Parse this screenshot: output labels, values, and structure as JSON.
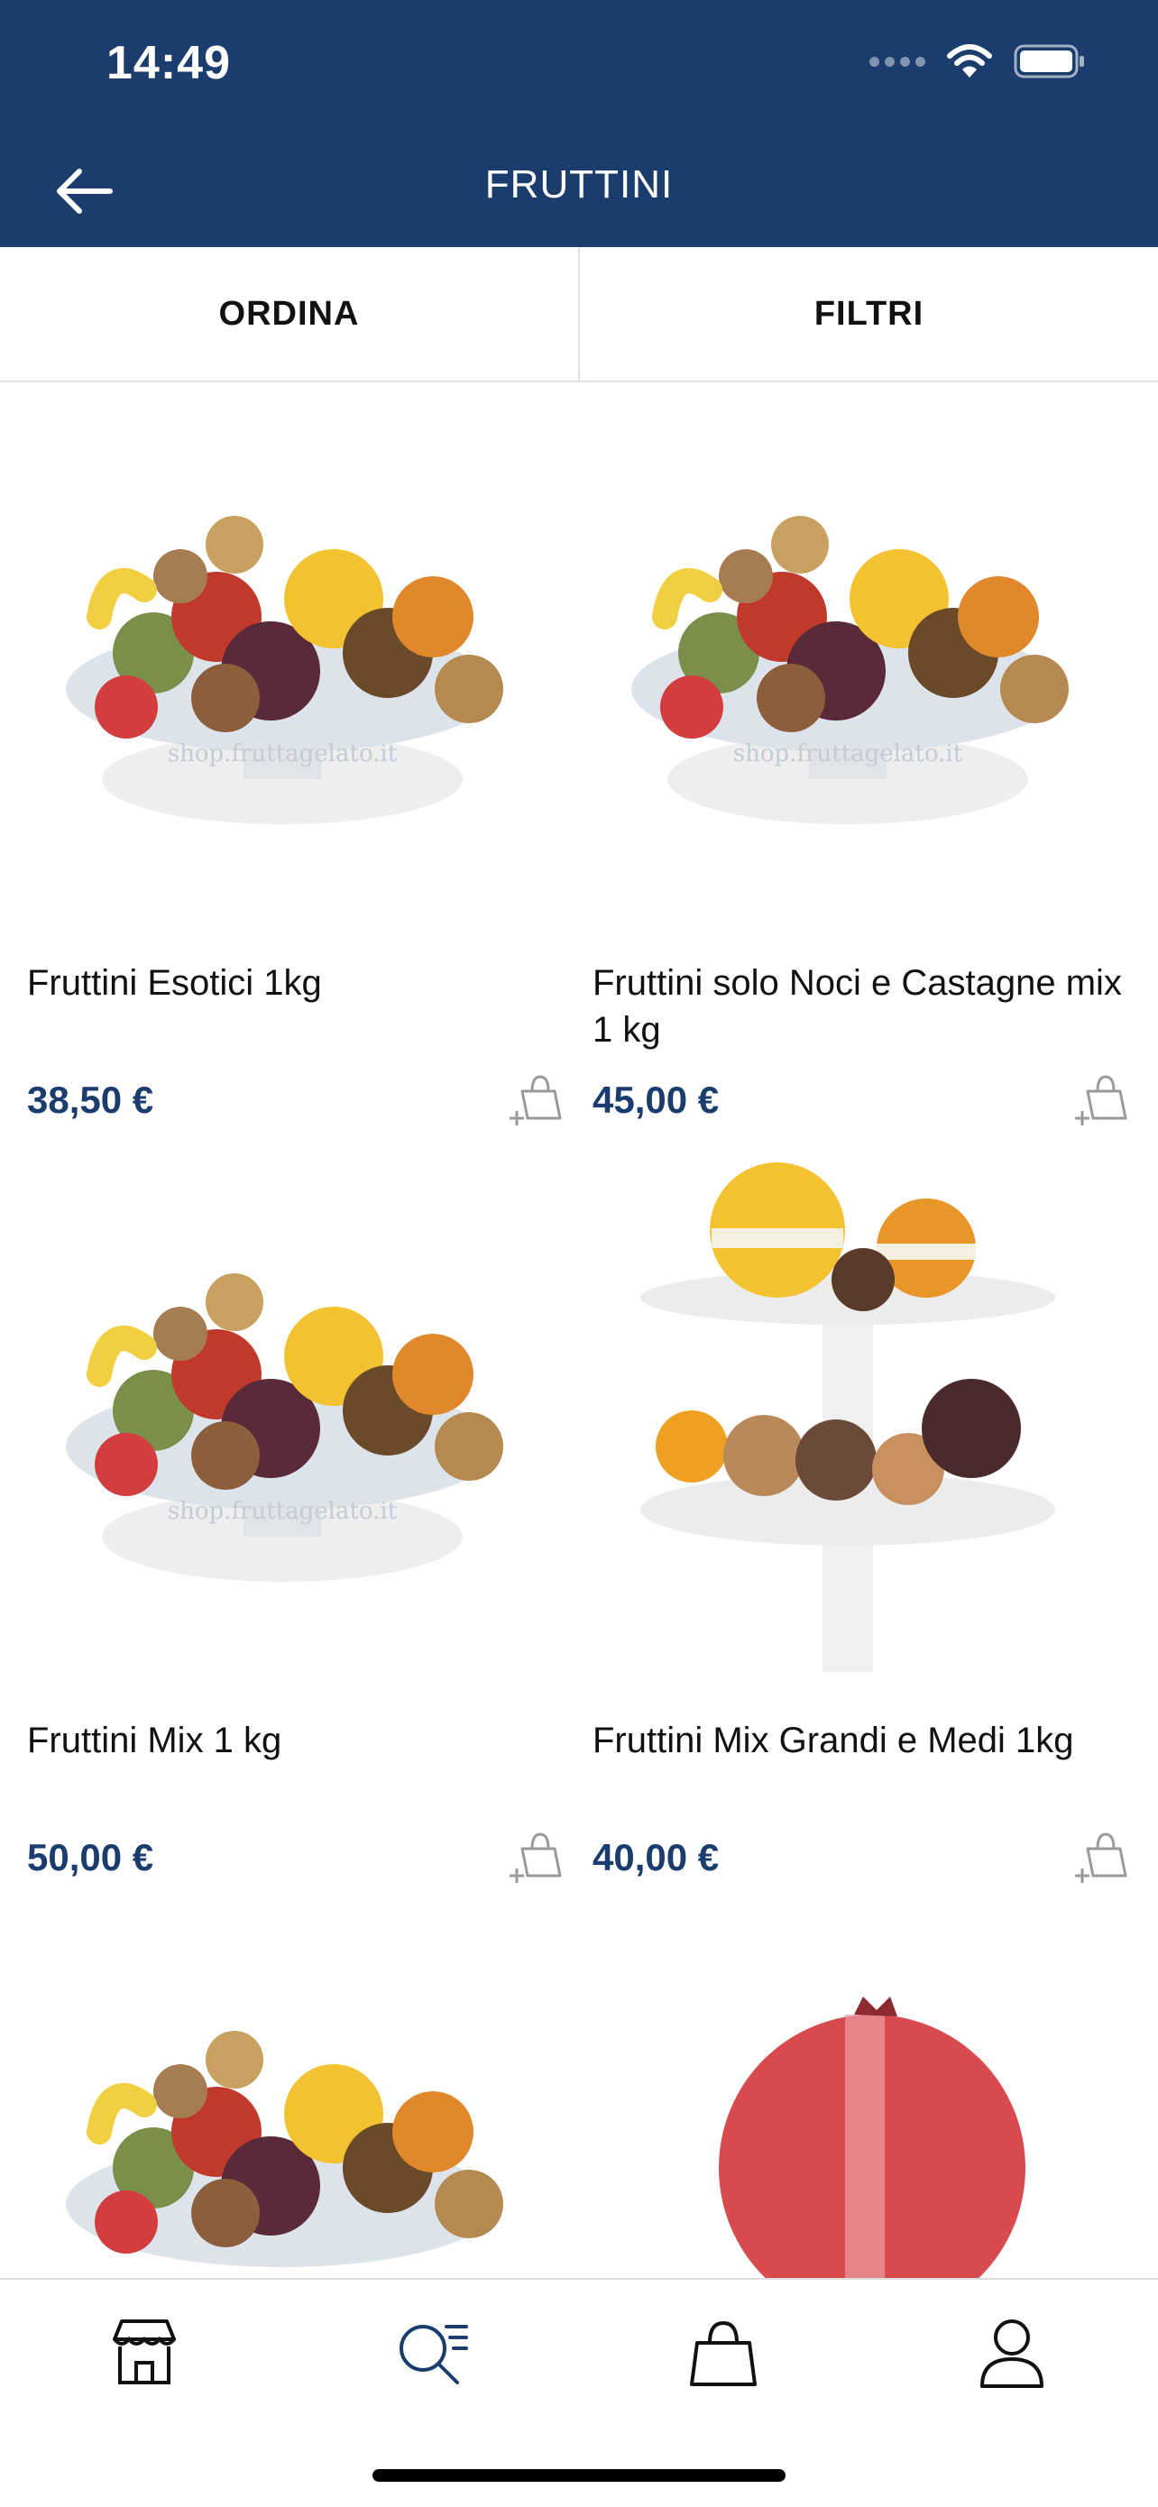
{
  "status_bar": {
    "time": "14:49",
    "icons": [
      "cellular-icon",
      "wifi-icon",
      "battery-icon"
    ]
  },
  "header": {
    "title": "FRUTTINI",
    "back_icon": "arrow-left-icon"
  },
  "toolbar": {
    "sort_label": "ORDINA",
    "filter_label": "FILTRI"
  },
  "products": [
    {
      "name": "Fruttini Esotici 1kg",
      "price": "38,50 €",
      "image": "fruit-bowl"
    },
    {
      "name": "Fruttini solo Noci e Castagne mix 1 kg",
      "price": "45,00 €",
      "image": "fruit-bowl"
    },
    {
      "name": "Fruttini Mix 1 kg",
      "price": "50,00 €",
      "image": "fruit-bowl"
    },
    {
      "name": "Fruttini Mix Grandi e Medi 1kg",
      "price": "40,00 €",
      "image": "fruit-stand"
    },
    {
      "name": "",
      "price": "",
      "image": "fruit-bowl"
    },
    {
      "name": "",
      "price": "",
      "image": "pomegranate"
    }
  ],
  "tab_bar": {
    "items": [
      "store-icon",
      "search-list-icon",
      "bag-icon",
      "user-icon"
    ],
    "active": 1
  },
  "colors": {
    "brand": "#1b3d6e",
    "active_tab": "#1b3d6e",
    "icon_gray": "#9a9a9a"
  }
}
